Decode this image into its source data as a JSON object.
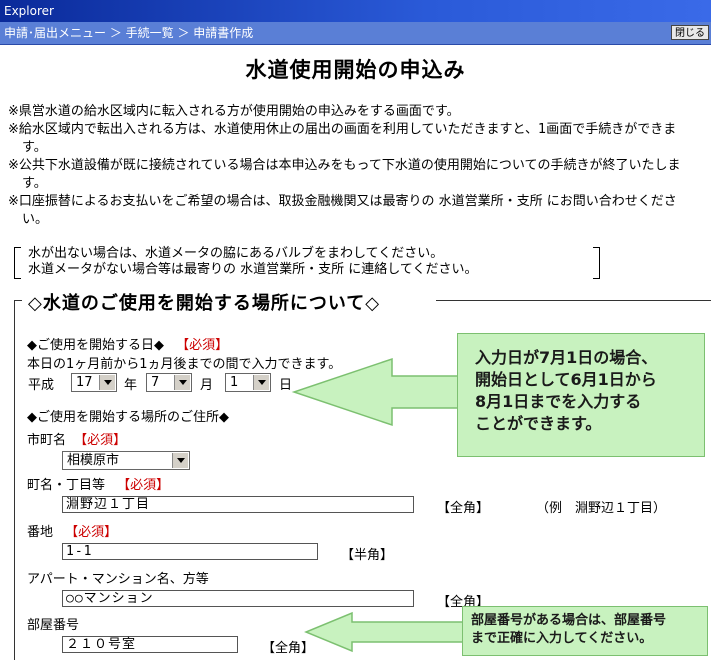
{
  "window": {
    "title": "Explorer"
  },
  "nav": {
    "breadcrumb": "申請･届出メニュー ＞ 手続一覧 ＞ 申請書作成",
    "close_label": "閉じる"
  },
  "page_title": "水道使用開始の申込み",
  "notes": [
    "※県営水道の給水区域内に転入される方が使用開始の申込みをする画面です。",
    "※給水区域内で転出入される方は、水道使用休止の届出の画面を利用していただきますと、1画面で手続きができます。",
    "※公共下水道設備が既に接続されている場合は本申込みをもって下水道の使用開始についての手続きが終了いたします。",
    "※口座振替によるお支払いをご希望の場合は、取扱金融機関又は最寄りの 水道営業所・支所 にお問い合わせください。"
  ],
  "bracket_notice": {
    "line1": "水が出ない場合は、水道メータの脇にあるバルブをまわしてください。",
    "line2": "水道メータがない場合等は最寄りの 水道営業所・支所 に連絡してください。"
  },
  "section_title": "◇水道のご使用を開始する場所について◇",
  "start_date": {
    "heading": "◆ご使用を開始する日◆",
    "required": "【必須】",
    "hint": "本日の1ヶ月前から1ヵ月後までの間で入力できます。",
    "era": "平成",
    "year": "17",
    "year_unit": "年",
    "month": "7",
    "month_unit": "月",
    "day": "1",
    "day_unit": "日"
  },
  "address": {
    "heading": "◆ご使用を開始する場所のご住所◆",
    "city_label": "市町名",
    "city_required": "【必須】",
    "city_value": "相模原市",
    "town_label": "町名・丁目等",
    "town_required": "【必須】",
    "town_value": "淵野辺１丁目",
    "town_note": "【全角】",
    "town_example": "（例　淵野辺１丁目）",
    "banchi_label": "番地",
    "banchi_required": "【必須】",
    "banchi_value": "1-1",
    "banchi_note": "【半角】",
    "building_label": "アパート・マンション名、方等",
    "building_value": "○○マンション",
    "building_note": "【全角】",
    "room_label": "部屋番号",
    "room_value": "２１０号室",
    "room_note": "【全角】"
  },
  "callouts": {
    "date": "入力日が7月1日の場合、\n開始日として6月1日から\n8月1日までを入力する\nことができます。",
    "room": "部屋番号がある場合は、部屋番号\nまで正確に入力してください。"
  },
  "colors": {
    "titlebar": "#0a2a9a",
    "navbar": "#5a7fd6",
    "required": "#cc0000",
    "callout_fill": "#c8f2bf",
    "callout_border": "#7cc070"
  }
}
